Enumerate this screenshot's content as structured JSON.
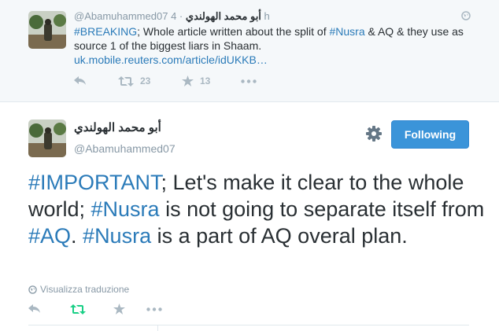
{
  "context_tweet": {
    "display_name": "أبو محمد الهولندي",
    "handle": "@Abamuhammed07",
    "separator": "·",
    "time": "4 h",
    "text_parts": [
      {
        "text": "#BREAKING",
        "type": "hashtag"
      },
      {
        "text": "; Whole article written about the split of ",
        "type": "text"
      },
      {
        "text": "#Nusra",
        "type": "hashtag"
      },
      {
        "text": " & AQ & they use as source 1 of the biggest liars in Shaam.",
        "type": "text"
      }
    ],
    "link": "uk.mobile.reuters.com/article/idUKKB…",
    "retweet_count": "23",
    "favorite_count": "13"
  },
  "main_tweet": {
    "display_name": "أبو محمد الهولندي",
    "handle": "@Abamuhammed07",
    "follow_label": "Following",
    "translate_label": "Visualizza traduzione",
    "text_parts": [
      {
        "text": "#IMPORTANT",
        "type": "hashtag"
      },
      {
        "text": "; Let's make it clear to the whole world; ",
        "type": "text"
      },
      {
        "text": "#Nusra",
        "type": "hashtag"
      },
      {
        "text": " is not going to separate itself from ",
        "type": "text"
      },
      {
        "text": "#AQ",
        "type": "hashtag"
      },
      {
        "text": ". ",
        "type": "text"
      },
      {
        "text": "#Nusra",
        "type": "hashtag"
      },
      {
        "text": " is a part of AQ overal plan.",
        "type": "text"
      }
    ]
  },
  "colors": {
    "link": "#2b7bb9",
    "follow_button": "#3b94d9",
    "retweeted_green": "#19cf86",
    "muted": "#8899a6",
    "icon_gray": "#aab8c2"
  }
}
